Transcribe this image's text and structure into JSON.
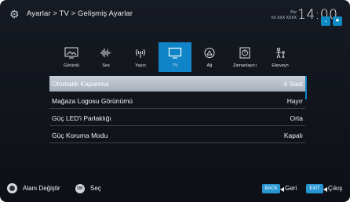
{
  "header": {
    "breadcrumb": "Ayarlar > TV > Gelişmiş Ayarlar",
    "day": "Per",
    "date": "XX XXX XXXX",
    "time": "14:00",
    "signal_icon": "dropdown-signal-icon",
    "bluetooth_icon": "bluetooth-icon"
  },
  "tabs": [
    {
      "label": "Görüntü",
      "icon": "picture-icon"
    },
    {
      "label": "Ses",
      "icon": "sound-icon"
    },
    {
      "label": "Yayın",
      "icon": "broadcast-icon"
    },
    {
      "label": "TV",
      "icon": "tv-icon"
    },
    {
      "label": "Ağ",
      "icon": "network-icon"
    },
    {
      "label": "Zamanlayıcı",
      "icon": "timer-icon"
    },
    {
      "label": "Ebeveyn",
      "icon": "parental-icon"
    }
  ],
  "active_tab": "TV",
  "settings": [
    {
      "label": "Otomatik Kapanma",
      "value": "4 Saat"
    },
    {
      "label": "Mağaza Logosu Görünümü",
      "value": "Hayır"
    },
    {
      "label": "Güç LED'i Parlaklığı",
      "value": "Orta"
    },
    {
      "label": "Güç Koruma Modu",
      "value": "Kapalı"
    }
  ],
  "footer": {
    "navigate_label": "Alanı Değiştir",
    "ok_key": "OK",
    "select_label": "Seç",
    "back_key": "BACK",
    "back_label": "Geri",
    "exit_key": "EXIT",
    "exit_label": "Çıkış"
  },
  "colors": {
    "accent": "#0f84c6",
    "background": "#12161d",
    "selected_row": "#b9c0c9"
  }
}
